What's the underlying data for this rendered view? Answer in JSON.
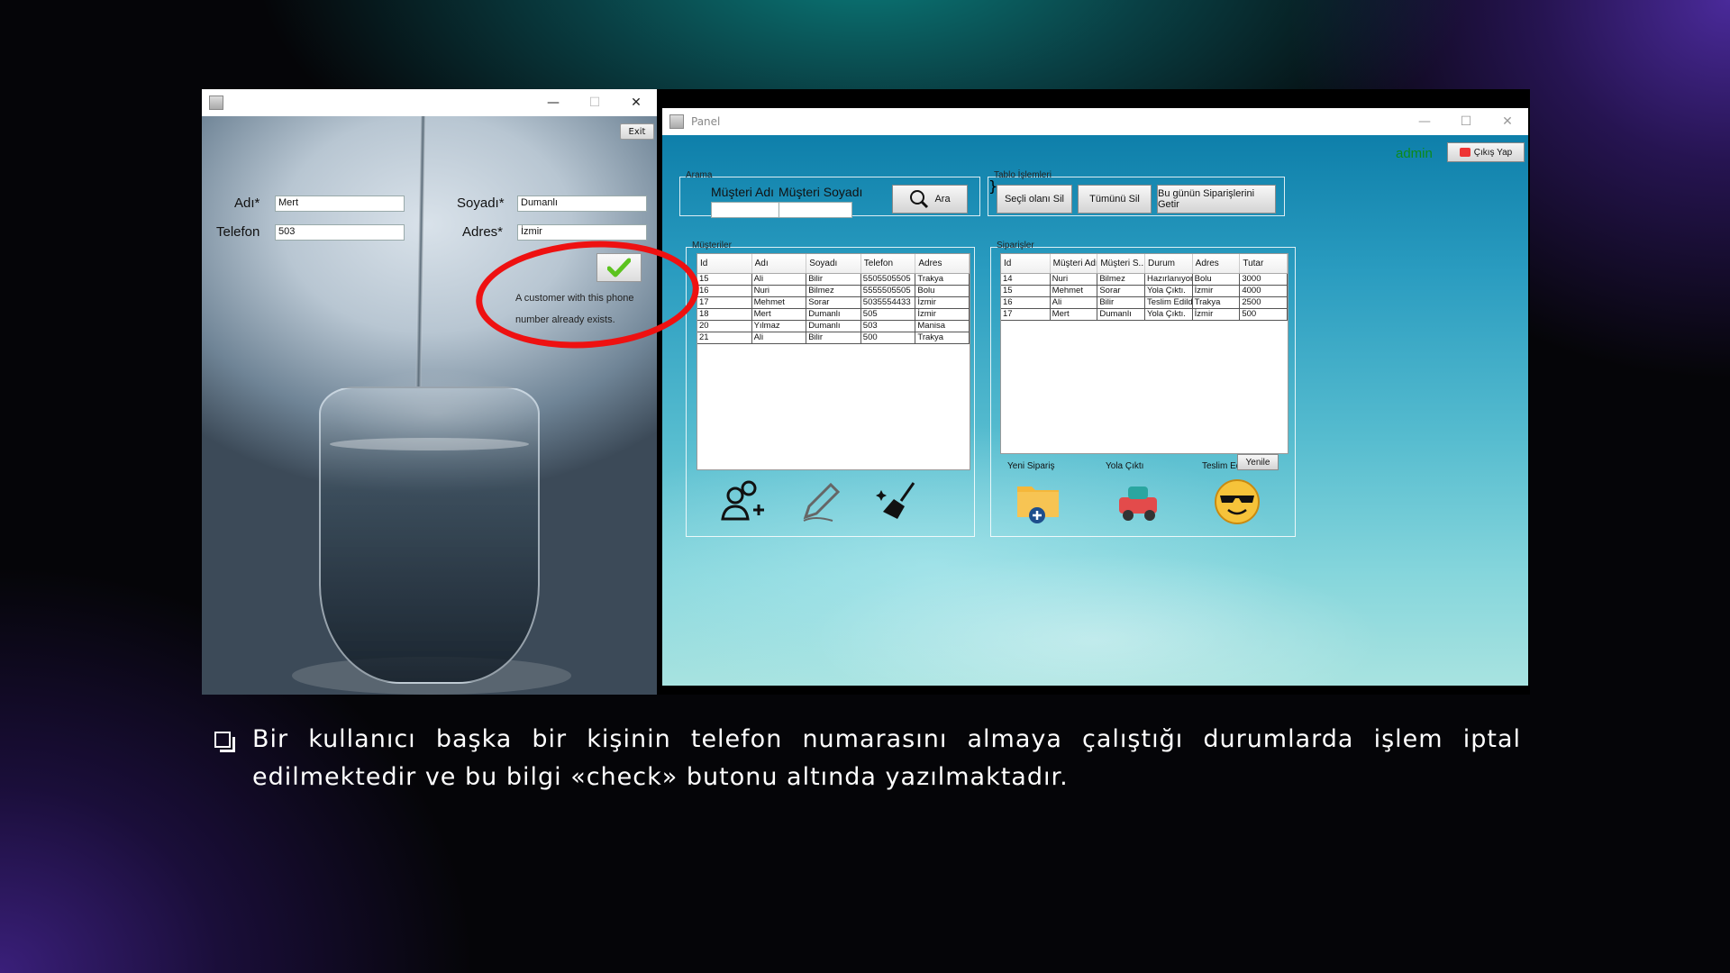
{
  "left_window": {
    "title": "",
    "exit_label": "Exit",
    "fields": [
      {
        "label": "Adı*",
        "value": "Mert"
      },
      {
        "label": "Soyadı*",
        "value": "Dumanlı"
      },
      {
        "label": "Telefon",
        "value": "503"
      },
      {
        "label": "Adres*",
        "value": "İzmir"
      }
    ],
    "message": "A customer with this phone number already exists."
  },
  "right_window": {
    "title": "Panel",
    "user": "admin",
    "logout_label": "Çıkış Yap",
    "search_group": {
      "label": "Arama",
      "first_name_label": "Müşteri Adı",
      "last_name_label": "Müşteri Soyadı",
      "search_button": "Ara"
    },
    "table_ops_group": {
      "label": "Tablo İşlemleri",
      "delete_selected": "Seçli olanı Sil",
      "delete_all": "Tümünü Sil",
      "today_orders": "Bu günün Siparişlerini Getir"
    },
    "customers": {
      "label": "Müşteriler",
      "columns": [
        "Id",
        "Adı",
        "Soyadı",
        "Telefon",
        "Adres"
      ],
      "rows": [
        [
          "15",
          "Ali",
          "Bilir",
          "5505505505",
          "Trakya"
        ],
        [
          "16",
          "Nuri",
          "Bilmez",
          "5555505505",
          "Bolu"
        ],
        [
          "17",
          "Mehmet",
          "Sorar",
          "5035554433",
          "İzmir"
        ],
        [
          "18",
          "Mert",
          "Dumanlı",
          "505",
          "İzmir"
        ],
        [
          "20",
          "Yılmaz",
          "Dumanlı",
          "503",
          "Manisa"
        ],
        [
          "21",
          "Ali",
          "Bilir",
          "500",
          "Trakya"
        ]
      ]
    },
    "orders": {
      "label": "Siparişler",
      "columns": [
        "Id",
        "Müşteri Adı",
        "Müşteri S...",
        "Durum",
        "Adres",
        "Tutar"
      ],
      "rows": [
        [
          "14",
          "Nuri",
          "Bilmez",
          "Hazırlanıyor.",
          "Bolu",
          "3000"
        ],
        [
          "15",
          "Mehmet",
          "Sorar",
          "Yola Çıktı.",
          "İzmir",
          "4000"
        ],
        [
          "16",
          "Ali",
          "Bilir",
          "Teslim Edildi.",
          "Trakya",
          "2500"
        ],
        [
          "17",
          "Mert",
          "Dumanlı",
          "Yola Çıktı.",
          "İzmir",
          "500"
        ]
      ],
      "status_labels": [
        "Yeni Sipariş",
        "Yola Çıktı",
        "Teslim Edildi"
      ],
      "refresh_label": "Yenile"
    }
  },
  "caption": "Bir kullanıcı başka bir kişinin telefon numarasını almaya çalıştığı durumlarda işlem iptal edilmektedir ve bu bilgi «check» butonu altında yazılmaktadır.",
  "colors": {
    "highlight_ellipse": "#e11111",
    "admin_text": "#0c8a1a",
    "check_icon": "#5cc31f"
  }
}
